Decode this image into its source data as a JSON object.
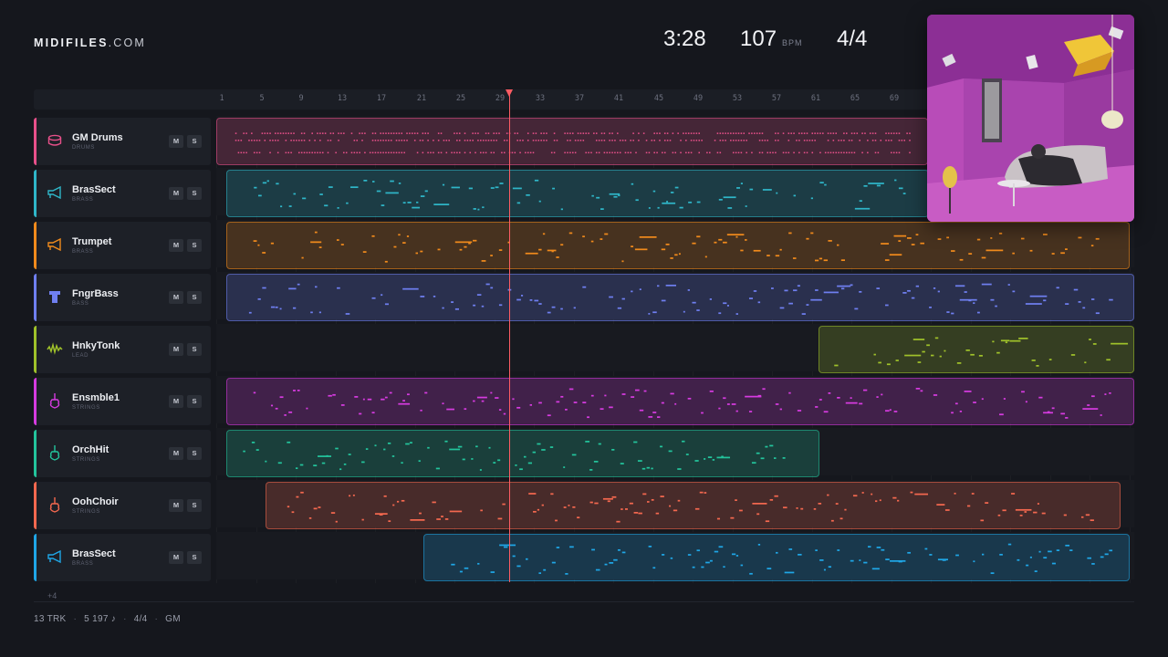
{
  "brand": {
    "name": "MIDIFILES",
    "suffix": ".COM"
  },
  "transport": {
    "time": "3:28",
    "bpm": "107",
    "bpm_unit": "BPM",
    "time_signature": "4/4"
  },
  "ruler": {
    "ticks": [
      "1",
      "5",
      "9",
      "13",
      "17",
      "21",
      "25",
      "29",
      "33",
      "37",
      "41",
      "45",
      "49",
      "53",
      "57",
      "61",
      "65",
      "69"
    ]
  },
  "mute_label": "M",
  "solo_label": "S",
  "tracks": [
    {
      "name": "GM Drums",
      "category": "DRUMS",
      "color": "#e8508a",
      "icon": "drum-icon"
    },
    {
      "name": "BrasSect",
      "category": "BRASS",
      "color": "#2fb6c8",
      "icon": "horn-icon"
    },
    {
      "name": "Trumpet",
      "category": "BRASS",
      "color": "#f08a1c",
      "icon": "horn-icon"
    },
    {
      "name": "FngrBass",
      "category": "BASS",
      "color": "#6f7ff0",
      "icon": "bass-icon"
    },
    {
      "name": "HnkyTonk",
      "category": "LEAD",
      "color": "#9fc12a",
      "icon": "wave-icon"
    },
    {
      "name": "Ensmble1",
      "category": "STRINGS",
      "color": "#d63be0",
      "icon": "violin-icon"
    },
    {
      "name": "OrchHit",
      "category": "STRINGS",
      "color": "#23c49c",
      "icon": "violin-icon"
    },
    {
      "name": "OohChoir",
      "category": "STRINGS",
      "color": "#f4684f",
      "icon": "violin-icon"
    },
    {
      "name": "BrasSect",
      "category": "BRASS",
      "color": "#1fa6e6",
      "icon": "horn-icon"
    }
  ],
  "more_tracks": "+4",
  "footer": {
    "tracks": "13 TRK",
    "notes": "5 197 ♪",
    "signature": "4/4",
    "standard": "GM"
  }
}
